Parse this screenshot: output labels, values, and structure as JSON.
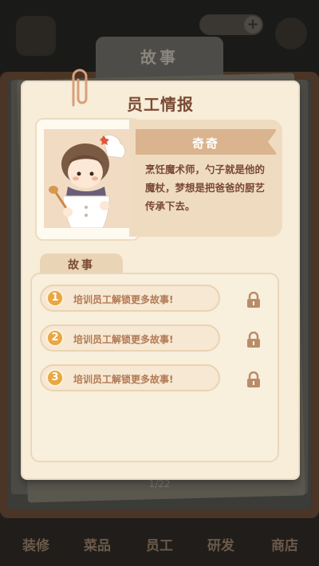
{
  "window_title": "故事",
  "card": {
    "title": "员工情报",
    "staff_name": "奇奇",
    "description": "烹饪魔术师，勺子就是他的魔杖，梦想是把爸爸的厨艺传承下去。"
  },
  "story_tab_label": "故事",
  "stories": [
    {
      "number": "1",
      "text": "培训员工解锁更多故事!",
      "locked": true
    },
    {
      "number": "2",
      "text": "培训员工解锁更多故事!",
      "locked": true
    },
    {
      "number": "3",
      "text": "培训员工解锁更多故事!",
      "locked": true
    }
  ],
  "page_indicator": "1/22",
  "bottom_nav": [
    "装修",
    "菜品",
    "员工",
    "研发",
    "商店"
  ],
  "colors": {
    "card_bg": "#f7edd9",
    "accent": "#e9a744",
    "text_brown": "#7a4a35"
  }
}
